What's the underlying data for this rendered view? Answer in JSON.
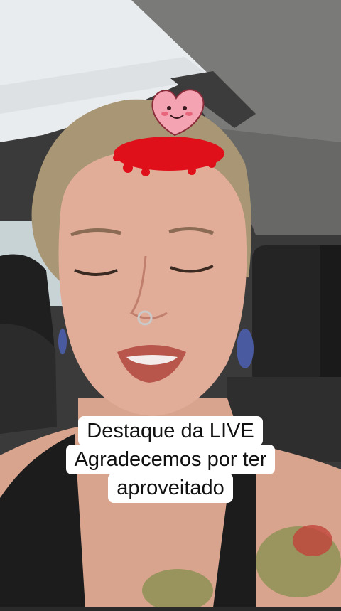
{
  "video": {
    "caption_lines": [
      "Destaque da LIVE",
      "Agradecemos por ter",
      "aproveitado"
    ]
  },
  "sticker": {
    "icon": "smiling-heart-sticker-icon",
    "heart_color": "#f4a3b3",
    "pile_color": "#e0101a"
  },
  "colors": {
    "caption_bg": "#ffffff",
    "caption_text": "#111111"
  }
}
